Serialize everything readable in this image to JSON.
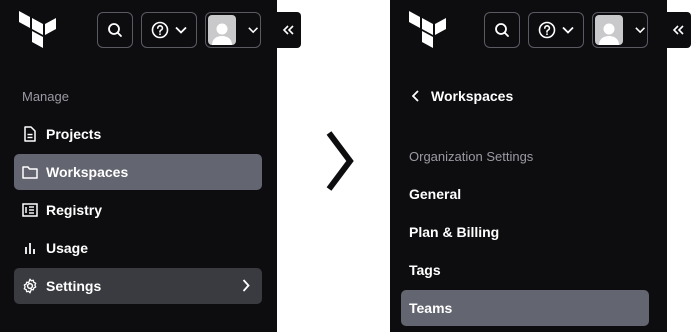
{
  "left_panel": {
    "section_label": "Manage",
    "items": [
      {
        "label": "Projects",
        "icon": "document-icon",
        "active": false
      },
      {
        "label": "Workspaces",
        "icon": "folder-icon",
        "active": true
      },
      {
        "label": "Registry",
        "icon": "registry-icon",
        "active": false
      },
      {
        "label": "Usage",
        "icon": "bar-chart-icon",
        "active": false
      },
      {
        "label": "Settings",
        "icon": "gear-icon",
        "active": false
      }
    ]
  },
  "right_panel": {
    "back_label": "Workspaces",
    "section_label": "Organization Settings",
    "items": [
      {
        "label": "General",
        "active": false
      },
      {
        "label": "Plan & Billing",
        "active": false
      },
      {
        "label": "Tags",
        "active": false
      },
      {
        "label": "Teams",
        "active": true
      }
    ]
  },
  "colors": {
    "sidebar_bg": "#0d0d10",
    "active_item_bg": "#636570",
    "settings_item_bg": "#3a3b41",
    "muted_text": "#9a9aa2",
    "text": "#ffffff"
  }
}
